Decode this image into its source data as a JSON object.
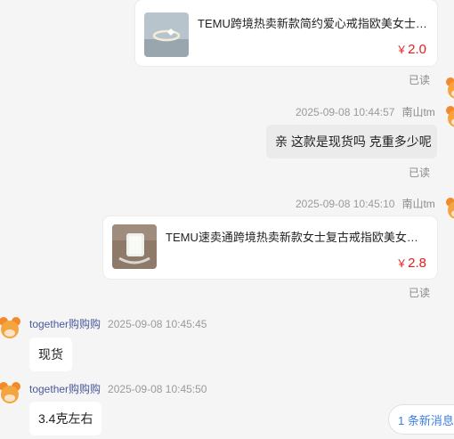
{
  "messages": {
    "product1": {
      "title": "TEMU跨境热卖新款简约爱心戒指欧美女士时尚...",
      "currency": "￥",
      "price": "2.0",
      "read": "已读"
    },
    "text1": {
      "timestamp": "2025-09-08 10:44:57",
      "sender": "南山tm",
      "text": "亲 这款是现货吗 克重多少呢",
      "read": "已读"
    },
    "product2": {
      "timestamp": "2025-09-08 10:45:10",
      "sender": "南山tm",
      "title": "TEMU速卖通跨境热卖新款女士复古戒指欧美女士订婚...",
      "currency": "￥",
      "price": "2.8",
      "read": "已读"
    },
    "reply1": {
      "nickname": "together购购购",
      "timestamp": "2025-09-08 10:45:45",
      "text": "现货"
    },
    "reply2": {
      "nickname": "together购购购",
      "timestamp": "2025-09-08 10:45:50",
      "text": "3.4克左右"
    }
  },
  "new_messages_label": "1 条新消息",
  "colors": {
    "price": "#e02020",
    "link": "#3b7fe0",
    "nickname": "#4a5a9a",
    "background": "#f5f5f5"
  },
  "icons": {
    "avatar": "cartoon-mascot-avatar"
  }
}
